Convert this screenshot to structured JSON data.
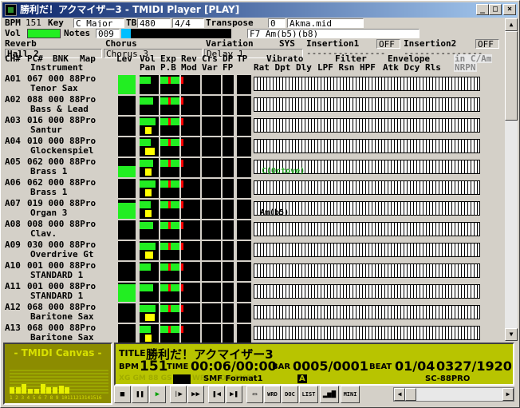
{
  "window": {
    "title": "勝利だ！アクマイザー3 - TMIDI Player [PLAY]",
    "min_label": "_",
    "max_label": "□",
    "close_label": "×"
  },
  "info": {
    "bpm_label": "BPM",
    "bpm": "151",
    "key_label": "Key",
    "key": "C Major",
    "tb_label": "TB",
    "tb": "480",
    "meter": "4/4",
    "transpose_label": "Transpose",
    "transpose": "0",
    "file": "Akma.mid",
    "vol_label": "Vol",
    "notes_label": "Notes",
    "notes": "009",
    "chord": "F7 Am(b5)(b8)",
    "reverb_label": "Reverb",
    "reverb": "Hall 2",
    "chorus_label": "Chorus",
    "chorus": "Chorus 3",
    "variation_label": "Variation",
    "variation": "Delay 1",
    "sys_label": "SYS",
    "ins1_label": "Insertion1",
    "ins1": "OFF",
    "ins2_label": "Insertion2",
    "ins2": "OFF",
    "ins1_val": "---------------",
    "ins2_val": "---------------"
  },
  "headers": {
    "ch": "CH#",
    "pc": "PC#",
    "bnk": "BNK",
    "map": "Map",
    "instrument": "Instrument",
    "lev": "Lev",
    "vol": "Vol",
    "exp": "Exp",
    "rev": "Rev",
    "crs": "Crs",
    "dp": "DP",
    "tp": "TP",
    "pan": "Pan",
    "pb": "P.B",
    "mod": "Mod",
    "var": "Var",
    "fp": "FP",
    "vibrato": "Vibrato",
    "vib_sub": "Rat Dpt Dly",
    "filter": "Filter",
    "filt_sub": "LPF Rsn HPF",
    "env": "Envelope",
    "env_sub": "Atk Dcy Rls",
    "inmode": "in C/Am",
    "nrpn": "NRPN"
  },
  "channels": [
    {
      "ch": "A01",
      "pc": "067 000 88Pro",
      "name": "Tenor Sax"
    },
    {
      "ch": "A02",
      "pc": "088 000 88Pro",
      "name": "Bass & Lead"
    },
    {
      "ch": "A03",
      "pc": "016 000 88Pro",
      "name": "Santur"
    },
    {
      "ch": "A04",
      "pc": "010 000 88Pro",
      "name": "Glockenspiel"
    },
    {
      "ch": "A05",
      "pc": "062 000 88Pro",
      "name": "Brass 1"
    },
    {
      "ch": "A06",
      "pc": "062 000 88Pro",
      "name": "Brass 1"
    },
    {
      "ch": "A07",
      "pc": "019 000 88Pro",
      "name": "Organ 3"
    },
    {
      "ch": "A08",
      "pc": "008 000 88Pro",
      "name": "Clav."
    },
    {
      "ch": "A09",
      "pc": "030 000 88Pro",
      "name": "Overdrive Gt"
    },
    {
      "ch": "A10",
      "pc": "001 000 88Pro",
      "name": "STANDARD 1"
    },
    {
      "ch": "A11",
      "pc": "001 000 88Pro",
      "name": "STANDARD 1"
    },
    {
      "ch": "A12",
      "pc": "068 000 88Pro",
      "name": "Baritone Sax"
    },
    {
      "ch": "A13",
      "pc": "068 000 88Pro",
      "name": "Baritone Sax"
    }
  ],
  "notes": {
    "a05": "C(Octove)",
    "a07": "Am(b5)"
  },
  "canvas": {
    "title": "- TMIDI Canvas -",
    "nums": "1 2 3 4 5 6 7 8 9 10111213141516"
  },
  "lcd": {
    "title_label": "TITLE",
    "title": "勝利だ！アクマイザー3",
    "bpm_label": "BPM",
    "bpm": "151",
    "time_label": "TIME",
    "time": "00:06/00:00",
    "bar_label": "BAR",
    "bar": "0005/0001",
    "beat_label": "BEAT",
    "beat": "01/04",
    "tick": "0327/1920",
    "smf": "SMF Format1",
    "flags": "XG GM  88  GS  JAM  WRD  DOC  SMFK",
    "a_label": "A",
    "module": "SC-88PRO"
  },
  "controls": {
    "wrd": "WRD",
    "doc": "DOC",
    "list": "LIST",
    "mini": "MINI"
  }
}
